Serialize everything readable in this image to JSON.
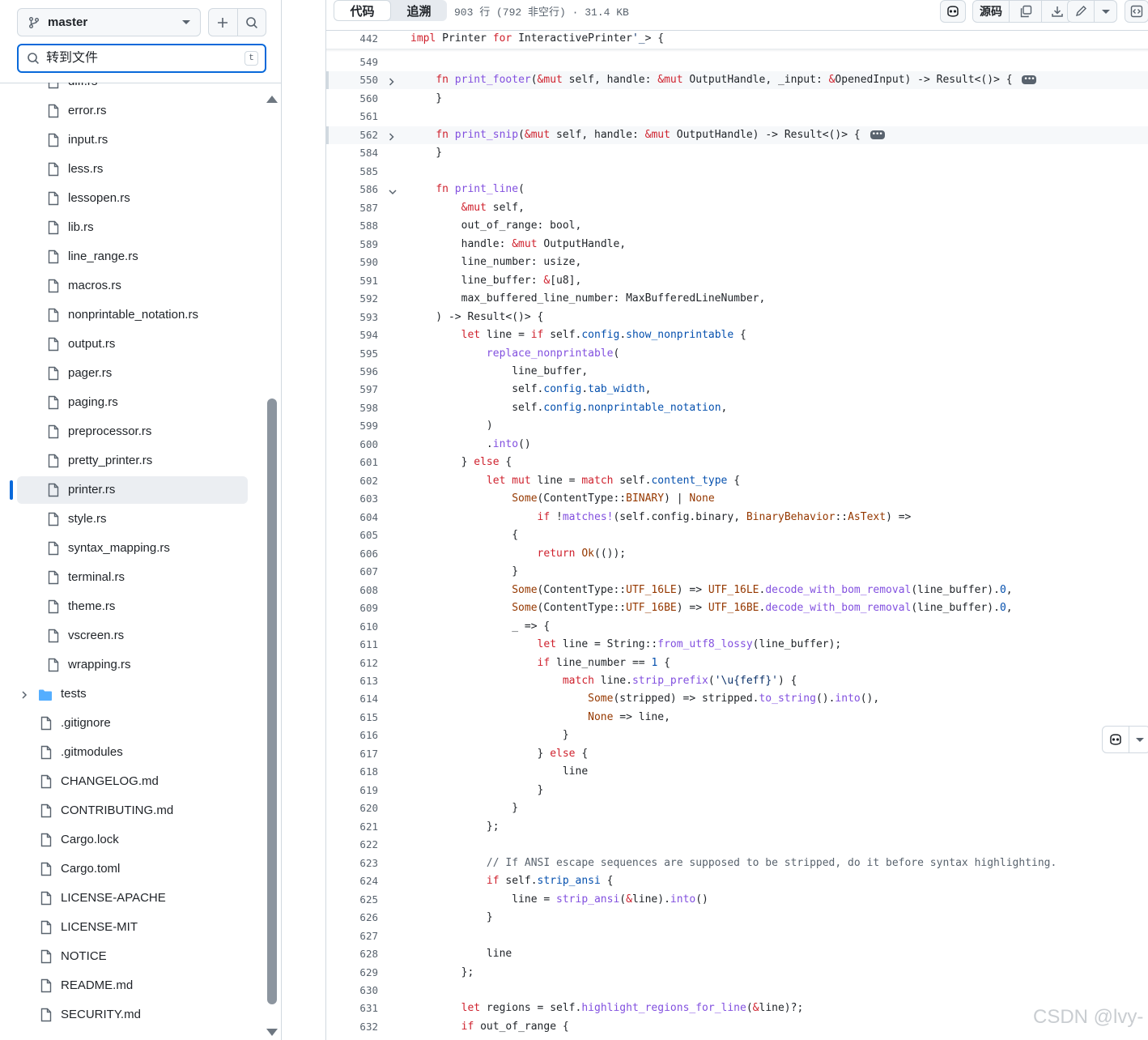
{
  "sidebar": {
    "branch": "master",
    "search_placeholder": "转到文件",
    "search_shortcut": "t",
    "items": [
      {
        "name": "diff.rs",
        "type": "file"
      },
      {
        "name": "error.rs",
        "type": "file"
      },
      {
        "name": "input.rs",
        "type": "file"
      },
      {
        "name": "less.rs",
        "type": "file"
      },
      {
        "name": "lessopen.rs",
        "type": "file"
      },
      {
        "name": "lib.rs",
        "type": "file"
      },
      {
        "name": "line_range.rs",
        "type": "file"
      },
      {
        "name": "macros.rs",
        "type": "file"
      },
      {
        "name": "nonprintable_notation.rs",
        "type": "file"
      },
      {
        "name": "output.rs",
        "type": "file"
      },
      {
        "name": "pager.rs",
        "type": "file"
      },
      {
        "name": "paging.rs",
        "type": "file"
      },
      {
        "name": "preprocessor.rs",
        "type": "file"
      },
      {
        "name": "pretty_printer.rs",
        "type": "file"
      },
      {
        "name": "printer.rs",
        "type": "file",
        "active": true
      },
      {
        "name": "style.rs",
        "type": "file"
      },
      {
        "name": "syntax_mapping.rs",
        "type": "file"
      },
      {
        "name": "terminal.rs",
        "type": "file"
      },
      {
        "name": "theme.rs",
        "type": "file"
      },
      {
        "name": "vscreen.rs",
        "type": "file"
      },
      {
        "name": "wrapping.rs",
        "type": "file"
      },
      {
        "name": "tests",
        "type": "folder"
      },
      {
        "name": ".gitignore",
        "type": "file"
      },
      {
        "name": ".gitmodules",
        "type": "file"
      },
      {
        "name": "CHANGELOG.md",
        "type": "file"
      },
      {
        "name": "CONTRIBUTING.md",
        "type": "file"
      },
      {
        "name": "Cargo.lock",
        "type": "file"
      },
      {
        "name": "Cargo.toml",
        "type": "file"
      },
      {
        "name": "LICENSE-APACHE",
        "type": "file"
      },
      {
        "name": "LICENSE-MIT",
        "type": "file"
      },
      {
        "name": "NOTICE",
        "type": "file"
      },
      {
        "name": "README.md",
        "type": "file"
      },
      {
        "name": "SECURITY.md",
        "type": "file"
      }
    ]
  },
  "toolbar": {
    "tab_code": "代码",
    "tab_blame": "追溯",
    "file_info": "903 行 (792 非空行) · 31.4 KB",
    "raw_label": "源码"
  },
  "code": {
    "lines": [
      {
        "n": "442",
        "html": "<span class=\"k\">impl</span> Printer <span class=\"k\">for</span> InteractivePrinter<span class=\"s\">'_</span>&gt; {"
      },
      {
        "n": "549",
        "html": ""
      },
      {
        "n": "550",
        "fold": "collapsed",
        "hl": true,
        "html": "    <span class=\"k\">fn</span> <span class=\"f\">print_footer</span>(<span class=\"k\">&amp;mut</span> self, handle: <span class=\"k\">&amp;mut</span> OutputHandle, _input: <span class=\"k\">&amp;</span>OpenedInput) -&gt; Result&lt;()&gt; { <span class=\"ellip\"></span>"
      },
      {
        "n": "560",
        "html": "    }"
      },
      {
        "n": "561",
        "html": ""
      },
      {
        "n": "562",
        "fold": "collapsed",
        "hl": true,
        "html": "    <span class=\"k\">fn</span> <span class=\"f\">print_snip</span>(<span class=\"k\">&amp;mut</span> self, handle: <span class=\"k\">&amp;mut</span> OutputHandle) -&gt; Result&lt;()&gt; { <span class=\"ellip\"></span>"
      },
      {
        "n": "584",
        "html": "    }"
      },
      {
        "n": "585",
        "html": ""
      },
      {
        "n": "586",
        "fold": "expanded",
        "html": "    <span class=\"k\">fn</span> <span class=\"f\">print_line</span>("
      },
      {
        "n": "587",
        "html": "        <span class=\"k\">&amp;mut</span> self,"
      },
      {
        "n": "588",
        "html": "        out_of_range: bool,"
      },
      {
        "n": "589",
        "html": "        handle: <span class=\"k\">&amp;mut</span> OutputHandle,"
      },
      {
        "n": "590",
        "html": "        line_number: usize,"
      },
      {
        "n": "591",
        "html": "        line_buffer: <span class=\"k\">&amp;</span>[u8],"
      },
      {
        "n": "592",
        "html": "        max_buffered_line_number: MaxBufferedLineNumber,"
      },
      {
        "n": "593",
        "html": "    ) -&gt; Result&lt;()&gt; {"
      },
      {
        "n": "594",
        "html": "        <span class=\"k\">let</span> line = <span class=\"k\">if</span> self.<span class=\"m\">config</span>.<span class=\"m\">show_nonprintable</span> {"
      },
      {
        "n": "595",
        "html": "            <span class=\"f\">replace_nonprintable</span>("
      },
      {
        "n": "596",
        "html": "                line_buffer,"
      },
      {
        "n": "597",
        "html": "                self.<span class=\"m\">config</span>.<span class=\"m\">tab_width</span>,"
      },
      {
        "n": "598",
        "html": "                self.<span class=\"m\">config</span>.<span class=\"m\">nonprintable_notation</span>,"
      },
      {
        "n": "599",
        "html": "            )"
      },
      {
        "n": "600",
        "html": "            .<span class=\"f\">into</span>()"
      },
      {
        "n": "601",
        "html": "        } <span class=\"k\">else</span> {"
      },
      {
        "n": "602",
        "html": "            <span class=\"k\">let</span> <span class=\"k\">mut</span> line = <span class=\"k\">match</span> self.<span class=\"m\">content_type</span> {"
      },
      {
        "n": "603",
        "html": "                <span class=\"n\">Some</span>(ContentType::<span class=\"n\">BINARY</span>) | <span class=\"n\">None</span>"
      },
      {
        "n": "604",
        "html": "                    <span class=\"k\">if</span> !<span class=\"f\">matches!</span>(self.config.binary, <span class=\"n\">BinaryBehavior</span>::<span class=\"n\">AsText</span>) =&gt;"
      },
      {
        "n": "605",
        "html": "                {"
      },
      {
        "n": "606",
        "html": "                    <span class=\"k\">return</span> <span class=\"n\">Ok</span>(());"
      },
      {
        "n": "607",
        "html": "                }"
      },
      {
        "n": "608",
        "html": "                <span class=\"n\">Some</span>(ContentType::<span class=\"n\">UTF_16LE</span>) =&gt; <span class=\"n\">UTF_16LE</span>.<span class=\"f\">decode_with_bom_removal</span>(line_buffer).<span class=\"m\">0</span>,"
      },
      {
        "n": "609",
        "html": "                <span class=\"n\">Some</span>(ContentType::<span class=\"n\">UTF_16BE</span>) =&gt; <span class=\"n\">UTF_16BE</span>.<span class=\"f\">decode_with_bom_removal</span>(line_buffer).<span class=\"m\">0</span>,"
      },
      {
        "n": "610",
        "html": "                _ =&gt; {"
      },
      {
        "n": "611",
        "html": "                    <span class=\"k\">let</span> line = String::<span class=\"f\">from_utf8_lossy</span>(line_buffer);"
      },
      {
        "n": "612",
        "html": "                    <span class=\"k\">if</span> line_number == <span class=\"m\">1</span> {"
      },
      {
        "n": "613",
        "html": "                        <span class=\"k\">match</span> line.<span class=\"f\">strip_prefix</span>(<span class=\"s\">'\\u{feff}'</span>) {"
      },
      {
        "n": "614",
        "html": "                            <span class=\"n\">Some</span>(stripped) =&gt; stripped.<span class=\"f\">to_string</span>().<span class=\"f\">into</span>(),"
      },
      {
        "n": "615",
        "html": "                            <span class=\"n\">None</span> =&gt; line,"
      },
      {
        "n": "616",
        "html": "                        }"
      },
      {
        "n": "617",
        "html": "                    } <span class=\"k\">else</span> {"
      },
      {
        "n": "618",
        "html": "                        line"
      },
      {
        "n": "619",
        "html": "                    }"
      },
      {
        "n": "620",
        "html": "                }"
      },
      {
        "n": "621",
        "html": "            };"
      },
      {
        "n": "622",
        "html": ""
      },
      {
        "n": "623",
        "html": "            <span class=\"c\">// If ANSI escape sequences are supposed to be stripped, do it before syntax highlighting.</span>"
      },
      {
        "n": "624",
        "html": "            <span class=\"k\">if</span> self.<span class=\"m\">strip_ansi</span> {"
      },
      {
        "n": "625",
        "html": "                line = <span class=\"f\">strip_ansi</span>(<span class=\"k\">&amp;</span>line).<span class=\"f\">into</span>()"
      },
      {
        "n": "626",
        "html": "            }"
      },
      {
        "n": "627",
        "html": ""
      },
      {
        "n": "628",
        "html": "            line"
      },
      {
        "n": "629",
        "html": "        };"
      },
      {
        "n": "630",
        "html": ""
      },
      {
        "n": "631",
        "html": "        <span class=\"k\">let</span> regions = self.<span class=\"f\">highlight_regions_for_line</span>(<span class=\"k\">&amp;</span>line)?;"
      },
      {
        "n": "632",
        "html": "        <span class=\"k\">if</span> out_of_range {"
      }
    ]
  },
  "watermark": "CSDN @lvy-",
  "icons": {
    "branch": "git-branch-icon",
    "add": "plus-icon",
    "search": "search-icon",
    "file": "file-icon",
    "folder": "folder-icon",
    "copilot": "copilot-icon",
    "copy": "copy-icon",
    "download": "download-icon",
    "edit": "pencil-icon",
    "symbols": "code-square-icon"
  },
  "colors": {
    "accent": "#0969da",
    "border": "#d1d9e0",
    "keyword": "#cf222e",
    "function": "#8250df",
    "constant": "#0550ae",
    "type": "#953800",
    "folder": "#54aeff"
  }
}
